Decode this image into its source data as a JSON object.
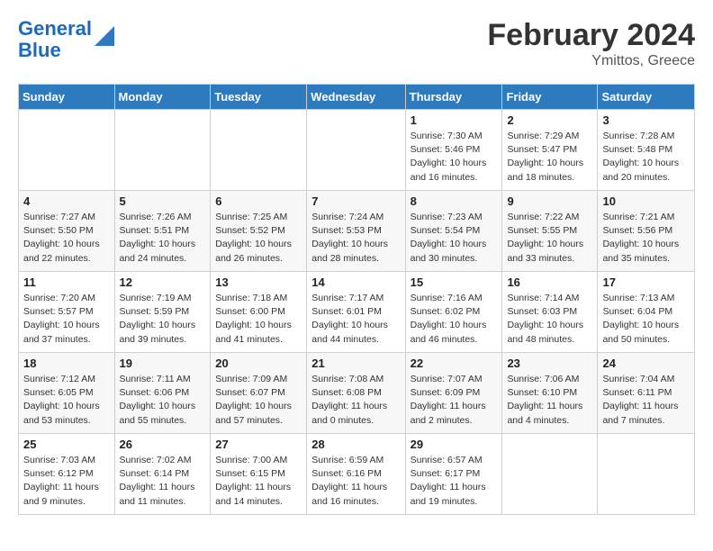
{
  "header": {
    "logo_line1": "General",
    "logo_line2": "Blue",
    "title": "February 2024",
    "subtitle": "Ymittos, Greece"
  },
  "columns": [
    "Sunday",
    "Monday",
    "Tuesday",
    "Wednesday",
    "Thursday",
    "Friday",
    "Saturday"
  ],
  "weeks": [
    [
      {
        "day": "",
        "info": ""
      },
      {
        "day": "",
        "info": ""
      },
      {
        "day": "",
        "info": ""
      },
      {
        "day": "",
        "info": ""
      },
      {
        "day": "1",
        "info": "Sunrise: 7:30 AM\nSunset: 5:46 PM\nDaylight: 10 hours\nand 16 minutes."
      },
      {
        "day": "2",
        "info": "Sunrise: 7:29 AM\nSunset: 5:47 PM\nDaylight: 10 hours\nand 18 minutes."
      },
      {
        "day": "3",
        "info": "Sunrise: 7:28 AM\nSunset: 5:48 PM\nDaylight: 10 hours\nand 20 minutes."
      }
    ],
    [
      {
        "day": "4",
        "info": "Sunrise: 7:27 AM\nSunset: 5:50 PM\nDaylight: 10 hours\nand 22 minutes."
      },
      {
        "day": "5",
        "info": "Sunrise: 7:26 AM\nSunset: 5:51 PM\nDaylight: 10 hours\nand 24 minutes."
      },
      {
        "day": "6",
        "info": "Sunrise: 7:25 AM\nSunset: 5:52 PM\nDaylight: 10 hours\nand 26 minutes."
      },
      {
        "day": "7",
        "info": "Sunrise: 7:24 AM\nSunset: 5:53 PM\nDaylight: 10 hours\nand 28 minutes."
      },
      {
        "day": "8",
        "info": "Sunrise: 7:23 AM\nSunset: 5:54 PM\nDaylight: 10 hours\nand 30 minutes."
      },
      {
        "day": "9",
        "info": "Sunrise: 7:22 AM\nSunset: 5:55 PM\nDaylight: 10 hours\nand 33 minutes."
      },
      {
        "day": "10",
        "info": "Sunrise: 7:21 AM\nSunset: 5:56 PM\nDaylight: 10 hours\nand 35 minutes."
      }
    ],
    [
      {
        "day": "11",
        "info": "Sunrise: 7:20 AM\nSunset: 5:57 PM\nDaylight: 10 hours\nand 37 minutes."
      },
      {
        "day": "12",
        "info": "Sunrise: 7:19 AM\nSunset: 5:59 PM\nDaylight: 10 hours\nand 39 minutes."
      },
      {
        "day": "13",
        "info": "Sunrise: 7:18 AM\nSunset: 6:00 PM\nDaylight: 10 hours\nand 41 minutes."
      },
      {
        "day": "14",
        "info": "Sunrise: 7:17 AM\nSunset: 6:01 PM\nDaylight: 10 hours\nand 44 minutes."
      },
      {
        "day": "15",
        "info": "Sunrise: 7:16 AM\nSunset: 6:02 PM\nDaylight: 10 hours\nand 46 minutes."
      },
      {
        "day": "16",
        "info": "Sunrise: 7:14 AM\nSunset: 6:03 PM\nDaylight: 10 hours\nand 48 minutes."
      },
      {
        "day": "17",
        "info": "Sunrise: 7:13 AM\nSunset: 6:04 PM\nDaylight: 10 hours\nand 50 minutes."
      }
    ],
    [
      {
        "day": "18",
        "info": "Sunrise: 7:12 AM\nSunset: 6:05 PM\nDaylight: 10 hours\nand 53 minutes."
      },
      {
        "day": "19",
        "info": "Sunrise: 7:11 AM\nSunset: 6:06 PM\nDaylight: 10 hours\nand 55 minutes."
      },
      {
        "day": "20",
        "info": "Sunrise: 7:09 AM\nSunset: 6:07 PM\nDaylight: 10 hours\nand 57 minutes."
      },
      {
        "day": "21",
        "info": "Sunrise: 7:08 AM\nSunset: 6:08 PM\nDaylight: 11 hours\nand 0 minutes."
      },
      {
        "day": "22",
        "info": "Sunrise: 7:07 AM\nSunset: 6:09 PM\nDaylight: 11 hours\nand 2 minutes."
      },
      {
        "day": "23",
        "info": "Sunrise: 7:06 AM\nSunset: 6:10 PM\nDaylight: 11 hours\nand 4 minutes."
      },
      {
        "day": "24",
        "info": "Sunrise: 7:04 AM\nSunset: 6:11 PM\nDaylight: 11 hours\nand 7 minutes."
      }
    ],
    [
      {
        "day": "25",
        "info": "Sunrise: 7:03 AM\nSunset: 6:12 PM\nDaylight: 11 hours\nand 9 minutes."
      },
      {
        "day": "26",
        "info": "Sunrise: 7:02 AM\nSunset: 6:14 PM\nDaylight: 11 hours\nand 11 minutes."
      },
      {
        "day": "27",
        "info": "Sunrise: 7:00 AM\nSunset: 6:15 PM\nDaylight: 11 hours\nand 14 minutes."
      },
      {
        "day": "28",
        "info": "Sunrise: 6:59 AM\nSunset: 6:16 PM\nDaylight: 11 hours\nand 16 minutes."
      },
      {
        "day": "29",
        "info": "Sunrise: 6:57 AM\nSunset: 6:17 PM\nDaylight: 11 hours\nand 19 minutes."
      },
      {
        "day": "",
        "info": ""
      },
      {
        "day": "",
        "info": ""
      }
    ]
  ]
}
